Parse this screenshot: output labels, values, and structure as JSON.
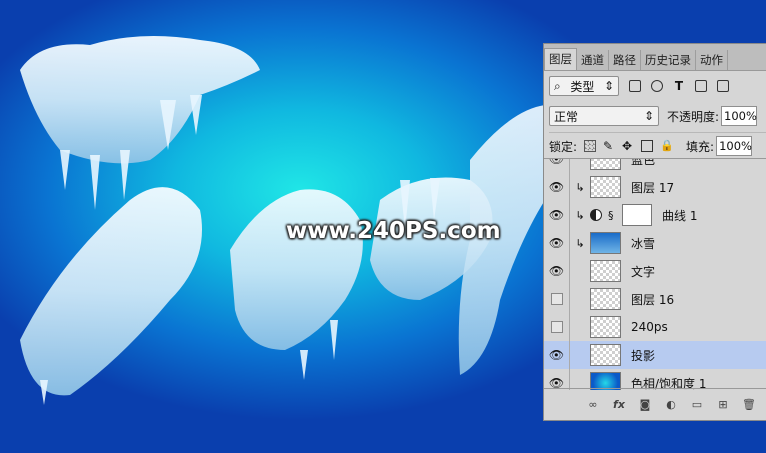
{
  "canvas": {
    "watermark": "www.240PS.com",
    "background_colors": [
      "#20e6e6",
      "#10b8e0",
      "#0a74d2",
      "#0a3fae"
    ]
  },
  "layers_panel": {
    "tabs": [
      "图层",
      "通道",
      "路径",
      "历史记录",
      "动作"
    ],
    "active_tab": "图层",
    "filter_kind": "类型",
    "blend_mode": "正常",
    "opacity_label": "不透明度:",
    "opacity_value": "100%",
    "lock_label": "锁定:",
    "fill_label": "填充:",
    "fill_value": "100%",
    "layers": [
      {
        "name": "蓝色",
        "visible": true,
        "clipped": false
      },
      {
        "name": "图层 17",
        "visible": true,
        "clipped": true
      },
      {
        "name": "曲线 1",
        "visible": true,
        "clipped": true
      },
      {
        "name": "冰雪",
        "visible": true,
        "clipped": true
      },
      {
        "name": "文字",
        "visible": true,
        "clipped": false
      },
      {
        "name": "图层 16",
        "visible": false,
        "clipped": false
      },
      {
        "name": "240ps",
        "visible": false,
        "clipped": false
      },
      {
        "name": "投影",
        "visible": true,
        "clipped": false,
        "selected": true
      },
      {
        "name": "色相/饱和度 1",
        "visible": true,
        "clipped": false
      }
    ],
    "footer_icons": [
      "link-icon",
      "fx-icon",
      "mask-icon",
      "adjustment-icon",
      "folder-icon",
      "new-layer-icon",
      "trash-icon"
    ],
    "selection_color": "#b7cbf0"
  }
}
